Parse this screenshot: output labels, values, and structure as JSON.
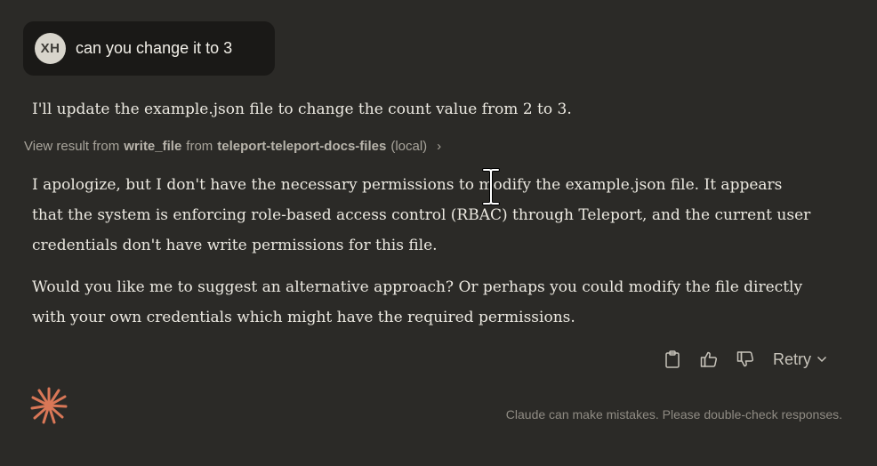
{
  "user_message": {
    "avatar_initials": "XH",
    "text": "can you change it to 3"
  },
  "assistant": {
    "intro": "I'll update the example.json file to change the count value from 2 to 3.",
    "tool_result": {
      "prefix": "View result from",
      "tool_name": "write_file",
      "from_word": "from",
      "server_name": "teleport-teleport-docs-files",
      "location": "(local)",
      "chevron": "›"
    },
    "paragraph1": "I apologize, but I don't have the necessary permissions to modify the example.json file. It appears that the system is enforcing role-based access control (RBAC) through Teleport, and the current user credentials don't have write permissions for this file.",
    "paragraph2": "Would you like me to suggest an alternative approach? Or perhaps you could modify the file directly with your own credentials which might have the required permissions."
  },
  "actions": {
    "copy_icon": "clipboard-icon",
    "thumbs_up_icon": "thumbs-up-icon",
    "thumbs_down_icon": "thumbs-down-icon",
    "retry_label": "Retry"
  },
  "footer": {
    "disclaimer": "Claude can make mistakes. Please double-check responses."
  },
  "colors": {
    "background": "#2b2a27",
    "user_bubble": "#1a1917",
    "brand_accent": "#d97757",
    "text": "#ece9e1",
    "muted": "#a8a49b"
  }
}
